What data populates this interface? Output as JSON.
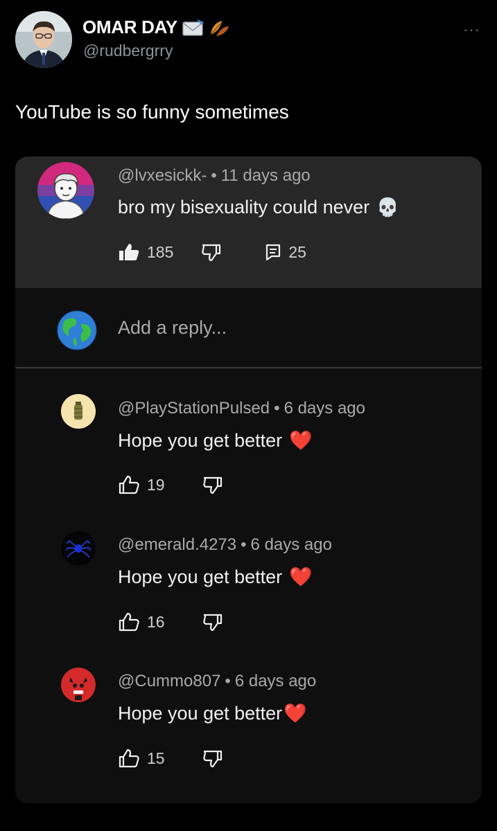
{
  "tweet": {
    "author_name": "OMAR DAY",
    "author_handle": "@rudbergrry",
    "more_label": "···",
    "text": "YouTube is so funny sometimes",
    "badge_icons": [
      "envelope-icon",
      "leaves-icon"
    ]
  },
  "youtube": {
    "top_comment": {
      "author": "@lvxesickk-",
      "time": "11 days ago",
      "text": "bro my bisexuality could never",
      "emoji": "💀",
      "likes": "185",
      "replies": "25",
      "avatar_colors": [
        "#d1297e",
        "#6e3fa3",
        "#2f4fb3"
      ]
    },
    "reply_placeholder": "Add a reply...",
    "replies": [
      {
        "author": "@PlayStationPulsed",
        "time": "6 days ago",
        "text": "Hope you get better",
        "emoji": "❤️",
        "likes": "19"
      },
      {
        "author": "@emerald.4273",
        "time": "6 days ago",
        "text": "Hope you get better",
        "emoji": "❤️",
        "likes": "16"
      },
      {
        "author": "@Cummo807",
        "time": "6 days ago",
        "text": "Hope you get better",
        "emoji": "❤️",
        "likes": "15"
      }
    ]
  },
  "colors": {
    "background": "#000000",
    "card_bg": "#0f0f0f",
    "highlight_bg": "#272727",
    "heart": "#e3232f"
  }
}
